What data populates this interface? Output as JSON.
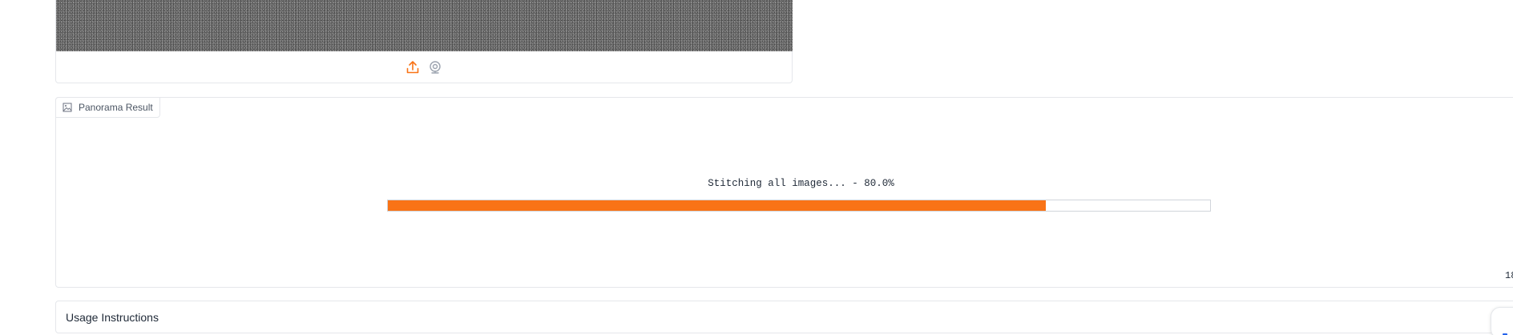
{
  "image_input": {
    "upload_icon": "upload-icon",
    "webcam_icon": "webcam-icon"
  },
  "result": {
    "label": "Panorama Result",
    "label_icon": "image-icon",
    "progress_text": "Stitching all images... - 80.0%",
    "progress_fraction": 0.8,
    "timer_text": "18",
    "accent_color": "#f97316"
  },
  "accordion": {
    "title": "Usage Instructions"
  }
}
